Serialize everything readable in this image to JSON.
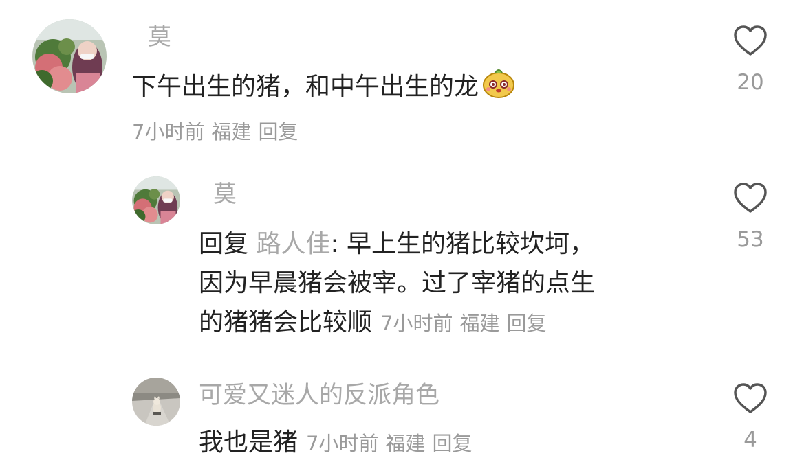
{
  "comments": [
    {
      "author": "莫",
      "text": "下午出生的猪，和中午出生的龙",
      "emoji": "smiling-mascot-emoji",
      "time": "7小时前",
      "location": "福建",
      "reply_label": "回复",
      "likes": "20",
      "avatar": "photo-avatar-flowers"
    },
    {
      "author": "莫",
      "reply_prefix": "回复",
      "reply_to": "路人佳",
      "text_line1": ": 早上生的猪比较坎坷，",
      "text_line2": "因为早晨猪会被宰。过了宰猪的点生",
      "text_line3": "的猪猪会比较顺",
      "time": "7小时前",
      "location": "福建",
      "reply_label": "回复",
      "likes": "53",
      "avatar": "photo-avatar-flowers"
    },
    {
      "author": "可爱又迷人的反派角色",
      "text": "我也是猪",
      "time": "7小时前",
      "location": "福建",
      "reply_label": "回复",
      "likes": "4",
      "avatar": "photo-avatar-cat-road"
    }
  ],
  "colors": {
    "text": "#222222",
    "muted": "#9a9a9a",
    "name": "#a8a8a8"
  },
  "icons": [
    "heart-outline-icon"
  ]
}
